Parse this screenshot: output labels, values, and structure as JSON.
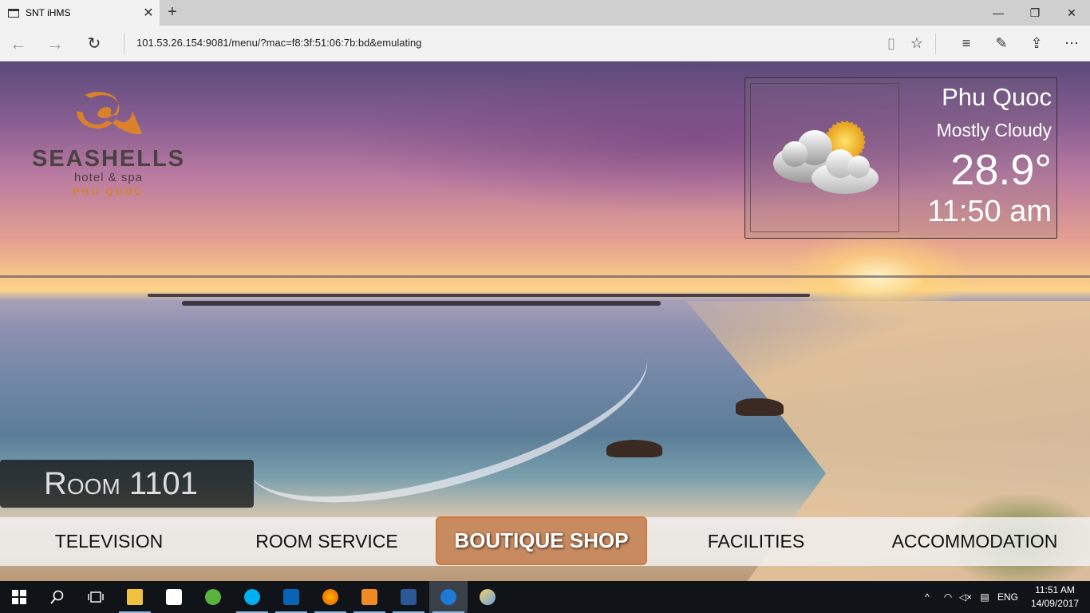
{
  "browser": {
    "tab_title": "SNT iHMS",
    "url": "101.53.26.154:9081/menu/?mac=f8:3f:51:06:7b:bd&emulating"
  },
  "logo": {
    "brand": "SEASHELLS",
    "subtitle": "hotel & spa",
    "location": "PHU QUOC"
  },
  "weather": {
    "city": "Phu Quoc",
    "condition": "Mostly Cloudy",
    "temperature": "28.9°",
    "time": "11:50 am",
    "icon": "partly-cloudy-icon"
  },
  "room": {
    "label": "Room 1101"
  },
  "menu": {
    "items": [
      {
        "label": "TELEVISION"
      },
      {
        "label": "ROOM SERVICE"
      },
      {
        "label": "BOUTIQUE SHOP",
        "active": true
      },
      {
        "label": "FACILITIES"
      },
      {
        "label": "ACCOMMODATION"
      }
    ]
  },
  "taskbar": {
    "language": "ENG",
    "time": "11:51 AM",
    "date": "14/09/2017"
  },
  "colors": {
    "accent": "#c88a5f",
    "logo_orange": "#d9822b",
    "logo_text": "#4a4142"
  }
}
